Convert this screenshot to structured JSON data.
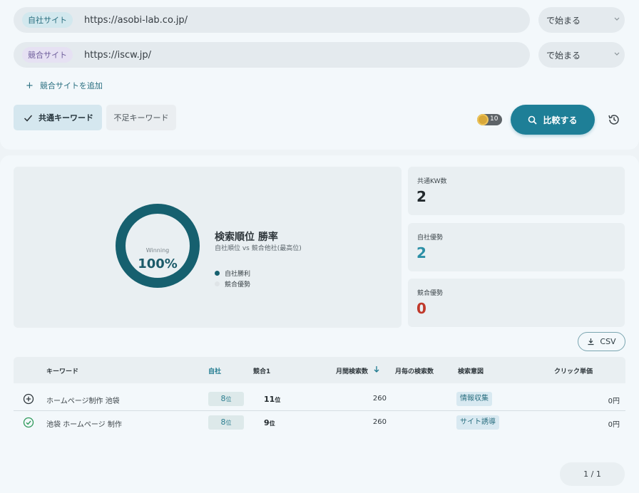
{
  "search": {
    "own_site": {
      "tag": "自社サイト",
      "url": "https://asobi-lab.co.jp/",
      "match": "で始まる"
    },
    "competitor_site": {
      "tag": "競合サイト",
      "url": "https://iscw.jp/",
      "match": "で始まる"
    },
    "add_competitor_label": "競合サイトを追加"
  },
  "tabs": {
    "common": "共通キーワード",
    "missing": "不足キーワード"
  },
  "credits": "10",
  "compare_label": "比較する",
  "winrate": {
    "donut_label": "Winning",
    "value": "100%",
    "value_fraction": 1.0,
    "title": "検索順位 勝率",
    "subtitle": "自社順位 vs 競合他社(最高位)",
    "legend": [
      {
        "label": "自社勝利",
        "color": "#16606f"
      },
      {
        "label": "競合優勢",
        "color": "#dfe4e7"
      }
    ]
  },
  "stats": {
    "common": {
      "label": "共通KW数",
      "value": "2",
      "color": "#22292d"
    },
    "own_advantage": {
      "label": "自社優勢",
      "value": "2",
      "color": "#2b8fa6"
    },
    "comp_advantage": {
      "label": "競合優勢",
      "value": "0",
      "color": "#c0392b"
    }
  },
  "csv_label": "CSV",
  "table": {
    "headers": {
      "keyword": "キーワード",
      "own": "自社",
      "comp": "競合1",
      "volume": "月間検索数",
      "monthly": "月毎の検索数",
      "intent": "検索意図",
      "cpc": "クリック単価"
    },
    "rows": [
      {
        "icon": "plus-circle-icon",
        "keyword": "ホームページ制作 池袋",
        "own_rank": "8",
        "comp_rank": "11",
        "rank_suffix": "位",
        "volume": "260",
        "intent": "情報収集",
        "cpc": "0円"
      },
      {
        "icon": "check-circle-icon",
        "keyword": "池袋 ホームページ 制作",
        "own_rank": "8",
        "comp_rank": "9",
        "rank_suffix": "位",
        "volume": "260",
        "intent": "サイト誘導",
        "cpc": "0円"
      }
    ]
  },
  "pagination": "1 / 1"
}
